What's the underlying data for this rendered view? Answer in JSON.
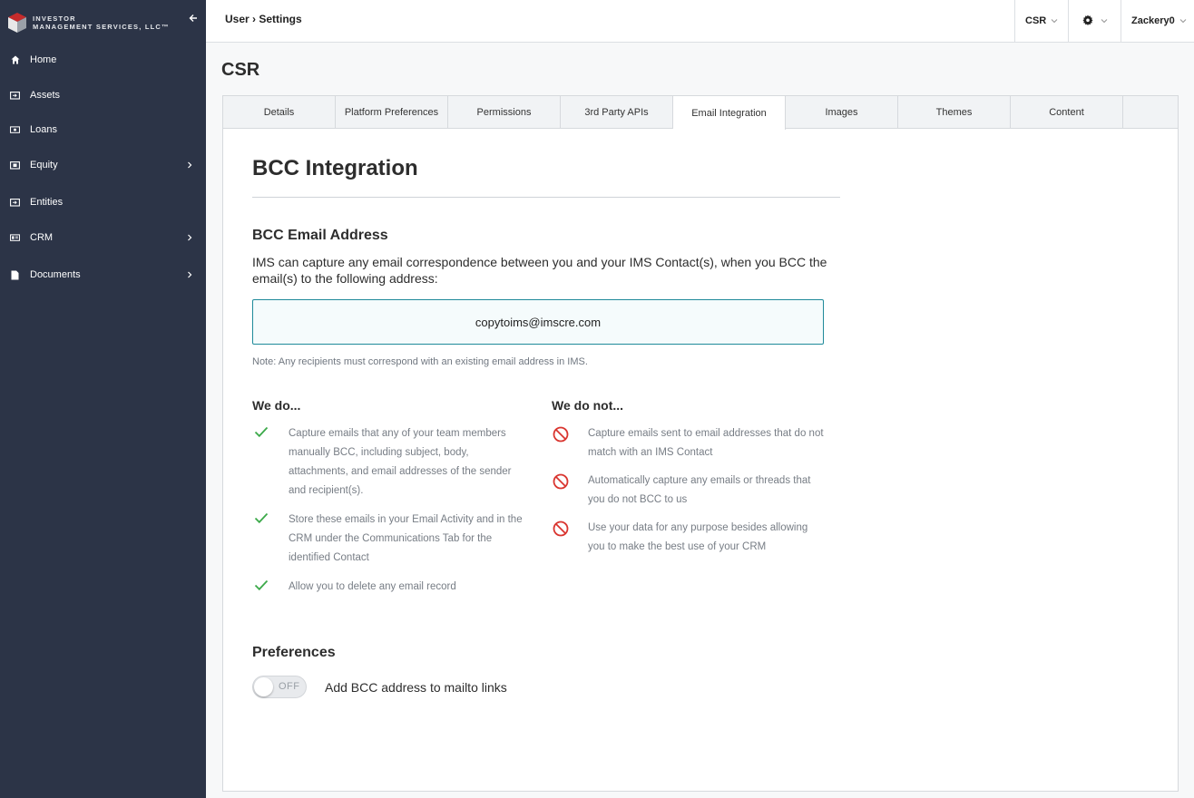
{
  "brand": {
    "line1": "INVESTOR",
    "line2": "MANAGEMENT SERVICES, LLC™",
    "red": "#c62b2b"
  },
  "sidebar": {
    "items": [
      {
        "label": "Home",
        "icon": "home-icon",
        "submenu": false
      },
      {
        "label": "Assets",
        "icon": "assets-icon",
        "submenu": false
      },
      {
        "label": "Loans",
        "icon": "loans-icon",
        "submenu": false
      },
      {
        "label": "Equity",
        "icon": "equity-icon",
        "submenu": true
      },
      {
        "label": "Entities",
        "icon": "entities-icon",
        "submenu": false
      },
      {
        "label": "CRM",
        "icon": "crm-icon",
        "submenu": true
      },
      {
        "label": "Documents",
        "icon": "documents-icon",
        "submenu": true
      }
    ]
  },
  "topbar": {
    "breadcrumb": "User › Settings",
    "org": "CSR",
    "settings_icon": "gear-icon",
    "user": "Zackery0"
  },
  "page": {
    "title": "CSR"
  },
  "tabs": [
    {
      "label": "Details",
      "active": false
    },
    {
      "label": "Platform Preferences",
      "active": false
    },
    {
      "label": "Permissions",
      "active": false
    },
    {
      "label": "3rd Party APIs",
      "active": false
    },
    {
      "label": "Email Integration",
      "active": true
    },
    {
      "label": "Images",
      "active": false
    },
    {
      "label": "Themes",
      "active": false
    },
    {
      "label": "Content",
      "active": false
    }
  ],
  "bcc": {
    "heading": "BCC Integration",
    "subheading": "BCC Email Address",
    "description": "IMS can capture any email correspondence between you and your IMS Contact(s), when you BCC the email(s) to the following address:",
    "address": "copytoims@imscre.com",
    "note": "Note: Any recipients must correspond with an existing email address in IMS.",
    "we_do_heading": "We do...",
    "we_do": [
      "Capture emails that any of your team members manually BCC, including subject, body, attachments, and email addresses of the sender and recipient(s).",
      "Store these emails in your Email Activity and in the CRM under the Communications Tab for the identified Contact",
      "Allow you to delete any email record"
    ],
    "we_do_not_heading": "We do not...",
    "we_do_not": [
      "Capture emails sent to email addresses that do not match with an IMS Contact",
      "Automatically capture any emails or threads that you do not BCC to us",
      "Use your data for any purpose besides allowing you to make the best use of your CRM"
    ],
    "check_color": "#3daa4b",
    "ban_color": "#d9352f"
  },
  "preferences": {
    "heading": "Preferences",
    "toggle_state": "OFF",
    "toggle_label": "Add BCC address to mailto links"
  }
}
